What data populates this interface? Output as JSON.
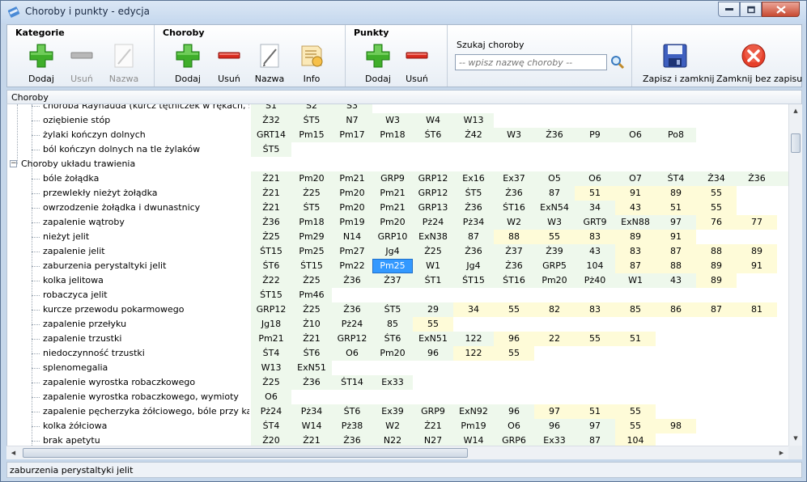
{
  "window": {
    "title": "Choroby i punkty - edycja"
  },
  "toolbar": {
    "kategorie": {
      "title": "Kategorie",
      "add": "Dodaj",
      "remove": "Usuń",
      "name": "Nazwa"
    },
    "choroby": {
      "title": "Choroby",
      "add": "Dodaj",
      "remove": "Usuń",
      "name": "Nazwa",
      "info": "Info"
    },
    "punkty": {
      "title": "Punkty",
      "add": "Dodaj",
      "remove": "Usuń"
    },
    "search": {
      "label": "Szukaj choroby",
      "placeholder": "-- wpisz nazwę choroby --"
    },
    "save_close": "Zapisz i zamknij",
    "close_nosave": "Zamknij bez zapisu"
  },
  "tree": {
    "header": "Choroby",
    "rows": [
      {
        "type": "item",
        "name": "choroba Raynauda (kurcz tętniczek w rękach, stó...",
        "cells": [
          [
            "Ś1",
            "g"
          ],
          [
            "Ś2",
            "g"
          ],
          [
            "Ś3",
            "g"
          ]
        ]
      },
      {
        "type": "item",
        "name": "oziębienie stóp",
        "cells": [
          [
            "Ż32",
            "g"
          ],
          [
            "ŚT5",
            "g"
          ],
          [
            "N7",
            "g"
          ],
          [
            "W3",
            "g"
          ],
          [
            "W4",
            "g"
          ],
          [
            "W13",
            "g"
          ]
        ]
      },
      {
        "type": "item",
        "name": "żylaki kończyn dolnych",
        "cells": [
          [
            "GRT14",
            "g"
          ],
          [
            "Pm15",
            "g"
          ],
          [
            "Pm17",
            "g"
          ],
          [
            "Pm18",
            "g"
          ],
          [
            "ŚT6",
            "g"
          ],
          [
            "Ż42",
            "g"
          ],
          [
            "W3",
            "g"
          ],
          [
            "Ż36",
            "g"
          ],
          [
            "P9",
            "g"
          ],
          [
            "O6",
            "g"
          ],
          [
            "Po8",
            "g"
          ]
        ]
      },
      {
        "type": "item",
        "name": "ból kończyn dolnych na tle żylaków",
        "cells": [
          [
            "ŚT5",
            "g"
          ]
        ]
      },
      {
        "type": "category",
        "name": "Choroby układu trawienia",
        "cells": []
      },
      {
        "type": "item",
        "name": "bóle żołądka",
        "cells": [
          [
            "Ż21",
            "g"
          ],
          [
            "Pm20",
            "g"
          ],
          [
            "Pm21",
            "g"
          ],
          [
            "GRP9",
            "g"
          ],
          [
            "GRP12",
            "g"
          ],
          [
            "Ex16",
            "g"
          ],
          [
            "Ex37",
            "g"
          ],
          [
            "O5",
            "g"
          ],
          [
            "O6",
            "g"
          ],
          [
            "O7",
            "g"
          ],
          [
            "ŚT4",
            "g"
          ],
          [
            "Ż34",
            "g"
          ],
          [
            "Ż36",
            "g"
          ],
          [
            "E",
            "g"
          ]
        ]
      },
      {
        "type": "item",
        "name": "przewlekły nieżyt żołądka",
        "cells": [
          [
            "Ż21",
            "g"
          ],
          [
            "Ż25",
            "g"
          ],
          [
            "Pm20",
            "g"
          ],
          [
            "Pm21",
            "g"
          ],
          [
            "GRP12",
            "g"
          ],
          [
            "ŚT5",
            "g"
          ],
          [
            "Ż36",
            "g"
          ],
          [
            "87",
            "g"
          ],
          [
            "51",
            "y"
          ],
          [
            "91",
            "y"
          ],
          [
            "89",
            "y"
          ],
          [
            "55",
            "y"
          ]
        ]
      },
      {
        "type": "item",
        "name": "owrzodzenie żołądka i dwunastnicy",
        "cells": [
          [
            "Ż21",
            "g"
          ],
          [
            "ŚT5",
            "g"
          ],
          [
            "Pm20",
            "g"
          ],
          [
            "Pm21",
            "g"
          ],
          [
            "GRP13",
            "g"
          ],
          [
            "Ż36",
            "g"
          ],
          [
            "ŚT16",
            "g"
          ],
          [
            "ExN54",
            "g"
          ],
          [
            "34",
            "g"
          ],
          [
            "43",
            "y"
          ],
          [
            "51",
            "y"
          ],
          [
            "55",
            "y"
          ]
        ]
      },
      {
        "type": "item",
        "name": "zapalenie wątroby",
        "cells": [
          [
            "Ż36",
            "g"
          ],
          [
            "Pm18",
            "g"
          ],
          [
            "Pm19",
            "g"
          ],
          [
            "Pm20",
            "g"
          ],
          [
            "Pż24",
            "g"
          ],
          [
            "Pż34",
            "g"
          ],
          [
            "W2",
            "g"
          ],
          [
            "W3",
            "g"
          ],
          [
            "GRT9",
            "g"
          ],
          [
            "ExN88",
            "g"
          ],
          [
            "97",
            "g"
          ],
          [
            "76",
            "y"
          ],
          [
            "77",
            "y"
          ]
        ]
      },
      {
        "type": "item",
        "name": "nieżyt jelit",
        "cells": [
          [
            "Ż25",
            "g"
          ],
          [
            "Pm29",
            "g"
          ],
          [
            "N14",
            "g"
          ],
          [
            "GRP10",
            "g"
          ],
          [
            "ExN38",
            "g"
          ],
          [
            "87",
            "g"
          ],
          [
            "88",
            "y"
          ],
          [
            "55",
            "y"
          ],
          [
            "83",
            "y"
          ],
          [
            "89",
            "y"
          ],
          [
            "91",
            "y"
          ]
        ]
      },
      {
        "type": "item",
        "name": "zapalenie jelit",
        "cells": [
          [
            "ŚT15",
            "g"
          ],
          [
            "Pm25",
            "g"
          ],
          [
            "Pm27",
            "g"
          ],
          [
            "Jg4",
            "g"
          ],
          [
            "Ż25",
            "g"
          ],
          [
            "Ż36",
            "g"
          ],
          [
            "Ż37",
            "g"
          ],
          [
            "Ż39",
            "g"
          ],
          [
            "43",
            "g"
          ],
          [
            "83",
            "y"
          ],
          [
            "87",
            "y"
          ],
          [
            "88",
            "y"
          ],
          [
            "89",
            "y"
          ]
        ]
      },
      {
        "type": "item",
        "name": "zaburzenia perystaltyki jelit",
        "cells": [
          [
            "ŚT6",
            "g"
          ],
          [
            "ŚT15",
            "g"
          ],
          [
            "Pm22",
            "g"
          ],
          [
            "Pm25",
            "sel"
          ],
          [
            "W1",
            "g"
          ],
          [
            "Jg4",
            "g"
          ],
          [
            "Ż36",
            "g"
          ],
          [
            "GRP5",
            "g"
          ],
          [
            "104",
            "g"
          ],
          [
            "87",
            "y"
          ],
          [
            "88",
            "y"
          ],
          [
            "89",
            "y"
          ],
          [
            "91",
            "y"
          ]
        ]
      },
      {
        "type": "item",
        "name": "kolka jelitowa",
        "cells": [
          [
            "Ż22",
            "g"
          ],
          [
            "Ż25",
            "g"
          ],
          [
            "Ż36",
            "g"
          ],
          [
            "Ż37",
            "g"
          ],
          [
            "ŚT1",
            "g"
          ],
          [
            "ŚT15",
            "g"
          ],
          [
            "ŚT16",
            "g"
          ],
          [
            "Pm20",
            "g"
          ],
          [
            "Pż40",
            "g"
          ],
          [
            "W1",
            "g"
          ],
          [
            "43",
            "g"
          ],
          [
            "89",
            "y"
          ]
        ]
      },
      {
        "type": "item",
        "name": "robaczyca jelit",
        "cells": [
          [
            "ŚT15",
            "g"
          ],
          [
            "Pm46",
            "g"
          ]
        ]
      },
      {
        "type": "item",
        "name": "kurcze przewodu pokarmowego",
        "cells": [
          [
            "GRP12",
            "g"
          ],
          [
            "Ż25",
            "g"
          ],
          [
            "Ż36",
            "g"
          ],
          [
            "ŚT5",
            "g"
          ],
          [
            "29",
            "g"
          ],
          [
            "34",
            "y"
          ],
          [
            "55",
            "y"
          ],
          [
            "82",
            "y"
          ],
          [
            "83",
            "y"
          ],
          [
            "85",
            "y"
          ],
          [
            "86",
            "y"
          ],
          [
            "87",
            "y"
          ],
          [
            "81",
            "y"
          ]
        ]
      },
      {
        "type": "item",
        "name": "zapalenie przełyku",
        "cells": [
          [
            "Jg18",
            "g"
          ],
          [
            "Ż10",
            "g"
          ],
          [
            "Pż24",
            "g"
          ],
          [
            "85",
            "g"
          ],
          [
            "55",
            "y"
          ]
        ]
      },
      {
        "type": "item",
        "name": "zapalenie trzustki",
        "cells": [
          [
            "Pm21",
            "g"
          ],
          [
            "Ż21",
            "g"
          ],
          [
            "GRP12",
            "g"
          ],
          [
            "ŚT6",
            "g"
          ],
          [
            "ExN51",
            "g"
          ],
          [
            "122",
            "g"
          ],
          [
            "96",
            "y"
          ],
          [
            "22",
            "y"
          ],
          [
            "55",
            "y"
          ],
          [
            "51",
            "y"
          ]
        ]
      },
      {
        "type": "item",
        "name": "niedoczynność trzustki",
        "cells": [
          [
            "ŚT4",
            "g"
          ],
          [
            "ŚT6",
            "g"
          ],
          [
            "O6",
            "g"
          ],
          [
            "Pm20",
            "g"
          ],
          [
            "96",
            "g"
          ],
          [
            "122",
            "y"
          ],
          [
            "55",
            "y"
          ]
        ]
      },
      {
        "type": "item",
        "name": "splenomegalia",
        "cells": [
          [
            "W13",
            "g"
          ],
          [
            "ExN51",
            "g"
          ]
        ]
      },
      {
        "type": "item",
        "name": "zapalenie wyrostka robaczkowego",
        "cells": [
          [
            "Ż25",
            "g"
          ],
          [
            "Ż36",
            "g"
          ],
          [
            "ŚT14",
            "g"
          ],
          [
            "Ex33",
            "g"
          ]
        ]
      },
      {
        "type": "item",
        "name": "zapalenie wyrostka robaczkowego, wymioty",
        "cells": [
          [
            "O6",
            "g"
          ]
        ]
      },
      {
        "type": "item",
        "name": "zapalenie pęcherzyka żółciowego, bóle przy kamicy",
        "cells": [
          [
            "Pż24",
            "g"
          ],
          [
            "Pż34",
            "g"
          ],
          [
            "ŚT6",
            "g"
          ],
          [
            "Ex39",
            "g"
          ],
          [
            "GRP9",
            "g"
          ],
          [
            "ExN92",
            "g"
          ],
          [
            "96",
            "g"
          ],
          [
            "97",
            "y"
          ],
          [
            "51",
            "y"
          ],
          [
            "55",
            "y"
          ]
        ]
      },
      {
        "type": "item",
        "name": "kolka żółciowa",
        "cells": [
          [
            "ŚT4",
            "g"
          ],
          [
            "W14",
            "g"
          ],
          [
            "Pż38",
            "g"
          ],
          [
            "W2",
            "g"
          ],
          [
            "Ż21",
            "g"
          ],
          [
            "Pm19",
            "g"
          ],
          [
            "O6",
            "g"
          ],
          [
            "96",
            "g"
          ],
          [
            "97",
            "g"
          ],
          [
            "55",
            "y"
          ],
          [
            "98",
            "y"
          ]
        ]
      },
      {
        "type": "item",
        "name": "brak apetytu",
        "cells": [
          [
            "Ż20",
            "g"
          ],
          [
            "Ż21",
            "g"
          ],
          [
            "Ż36",
            "g"
          ],
          [
            "N22",
            "g"
          ],
          [
            "N27",
            "g"
          ],
          [
            "W14",
            "g"
          ],
          [
            "GRP6",
            "g"
          ],
          [
            "Ex33",
            "g"
          ],
          [
            "87",
            "g"
          ],
          [
            "104",
            "y"
          ]
        ]
      }
    ]
  },
  "status": {
    "text": "zaburzenia perystaltyki jelit"
  }
}
